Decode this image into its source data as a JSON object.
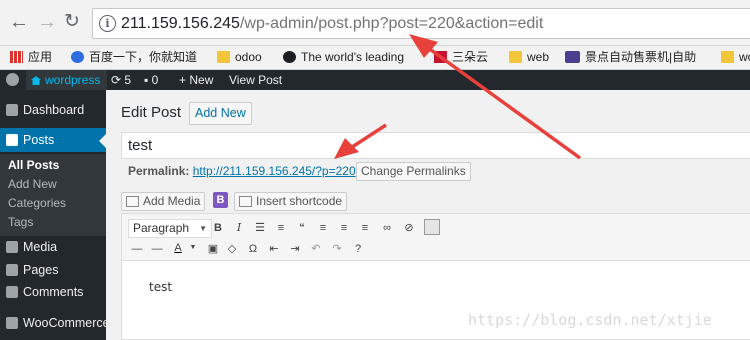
{
  "browser": {
    "url_host": "211.159.156.245",
    "url_path": "/wp-admin/post.php?post=220&action=edit",
    "bookmarks": [
      "应用",
      "百度一下，你就知道",
      "odoo",
      "The world's leading",
      "三朵云",
      "web",
      "景点自动售票机|自助",
      "wo"
    ]
  },
  "adminbar": {
    "site_name": "wordpress",
    "updates": "5",
    "comments": "0",
    "new_label": "New",
    "view_post": "View Post"
  },
  "sidebar": {
    "items": [
      "Dashboard",
      "Posts",
      "Media",
      "Pages",
      "Comments",
      "WooCommerce"
    ],
    "submenu": [
      "All Posts",
      "Add New",
      "Categories",
      "Tags"
    ]
  },
  "editor": {
    "page_title": "Edit Post",
    "add_new": "Add New",
    "post_title": "test",
    "permalink_label": "Permalink:",
    "permalink_url": "http://211.159.156.245/?p=220",
    "change_permalinks": "Change Permalinks",
    "add_media": "Add Media",
    "b_badge": "B",
    "insert_shortcode": "Insert shortcode",
    "format_select": "Paragraph",
    "body_text": "test"
  },
  "watermark": "https://blog.csdn.net/xtjie",
  "colors": {
    "admin_bar": "#23282d",
    "accent": "#0073aa",
    "annotation_arrow": "#e8403a"
  }
}
